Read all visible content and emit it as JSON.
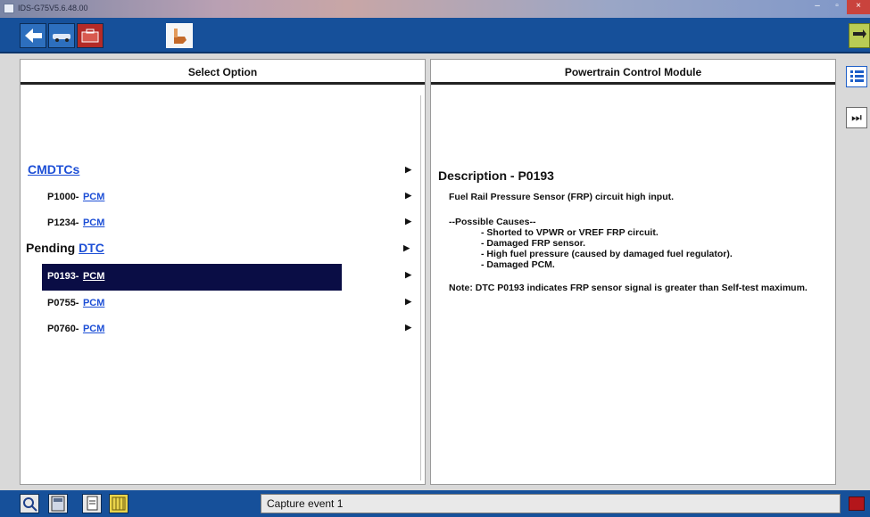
{
  "window": {
    "title": "IDS-G75V5.6.48.00"
  },
  "panes": {
    "left_header": "Select Option",
    "right_header": "Powertrain Control Module"
  },
  "tree": {
    "category_1": "CMDTCs",
    "items_1": [
      {
        "code": "P1000-",
        "module": "PCM"
      },
      {
        "code": "P1234-",
        "module": "PCM"
      }
    ],
    "category_2_prefix": "Pending ",
    "category_2_link": "DTC",
    "items_2": [
      {
        "code": "P0193-",
        "module": "PCM",
        "selected": true
      },
      {
        "code": "P0755-",
        "module": "PCM"
      },
      {
        "code": "P0760-",
        "module": "PCM"
      }
    ]
  },
  "description": {
    "title": "Description - P0193",
    "summary": "Fuel Rail Pressure Sensor (FRP) circuit high input.",
    "causes_header": "--Possible Causes--",
    "causes": [
      "- Shorted to VPWR or VREF FRP circuit.",
      "- Damaged FRP sensor.",
      "- High fuel pressure (caused by damaged fuel regulator).",
      "- Damaged PCM."
    ],
    "note": "Note: DTC P0193 indicates FRP sensor signal is greater than Self-test maximum."
  },
  "status": {
    "message": "Capture event 1"
  },
  "icons": {
    "toolbar": [
      "back-arrow-icon",
      "vehicle-icon",
      "toolbox-icon",
      "hand-pointer-icon",
      "connection-icon"
    ],
    "side": [
      "list-icon",
      "skip-forward-icon"
    ],
    "statusbar": [
      "search-icon",
      "calculator-icon",
      "document-icon",
      "grid-icon",
      "battery-icon"
    ]
  }
}
